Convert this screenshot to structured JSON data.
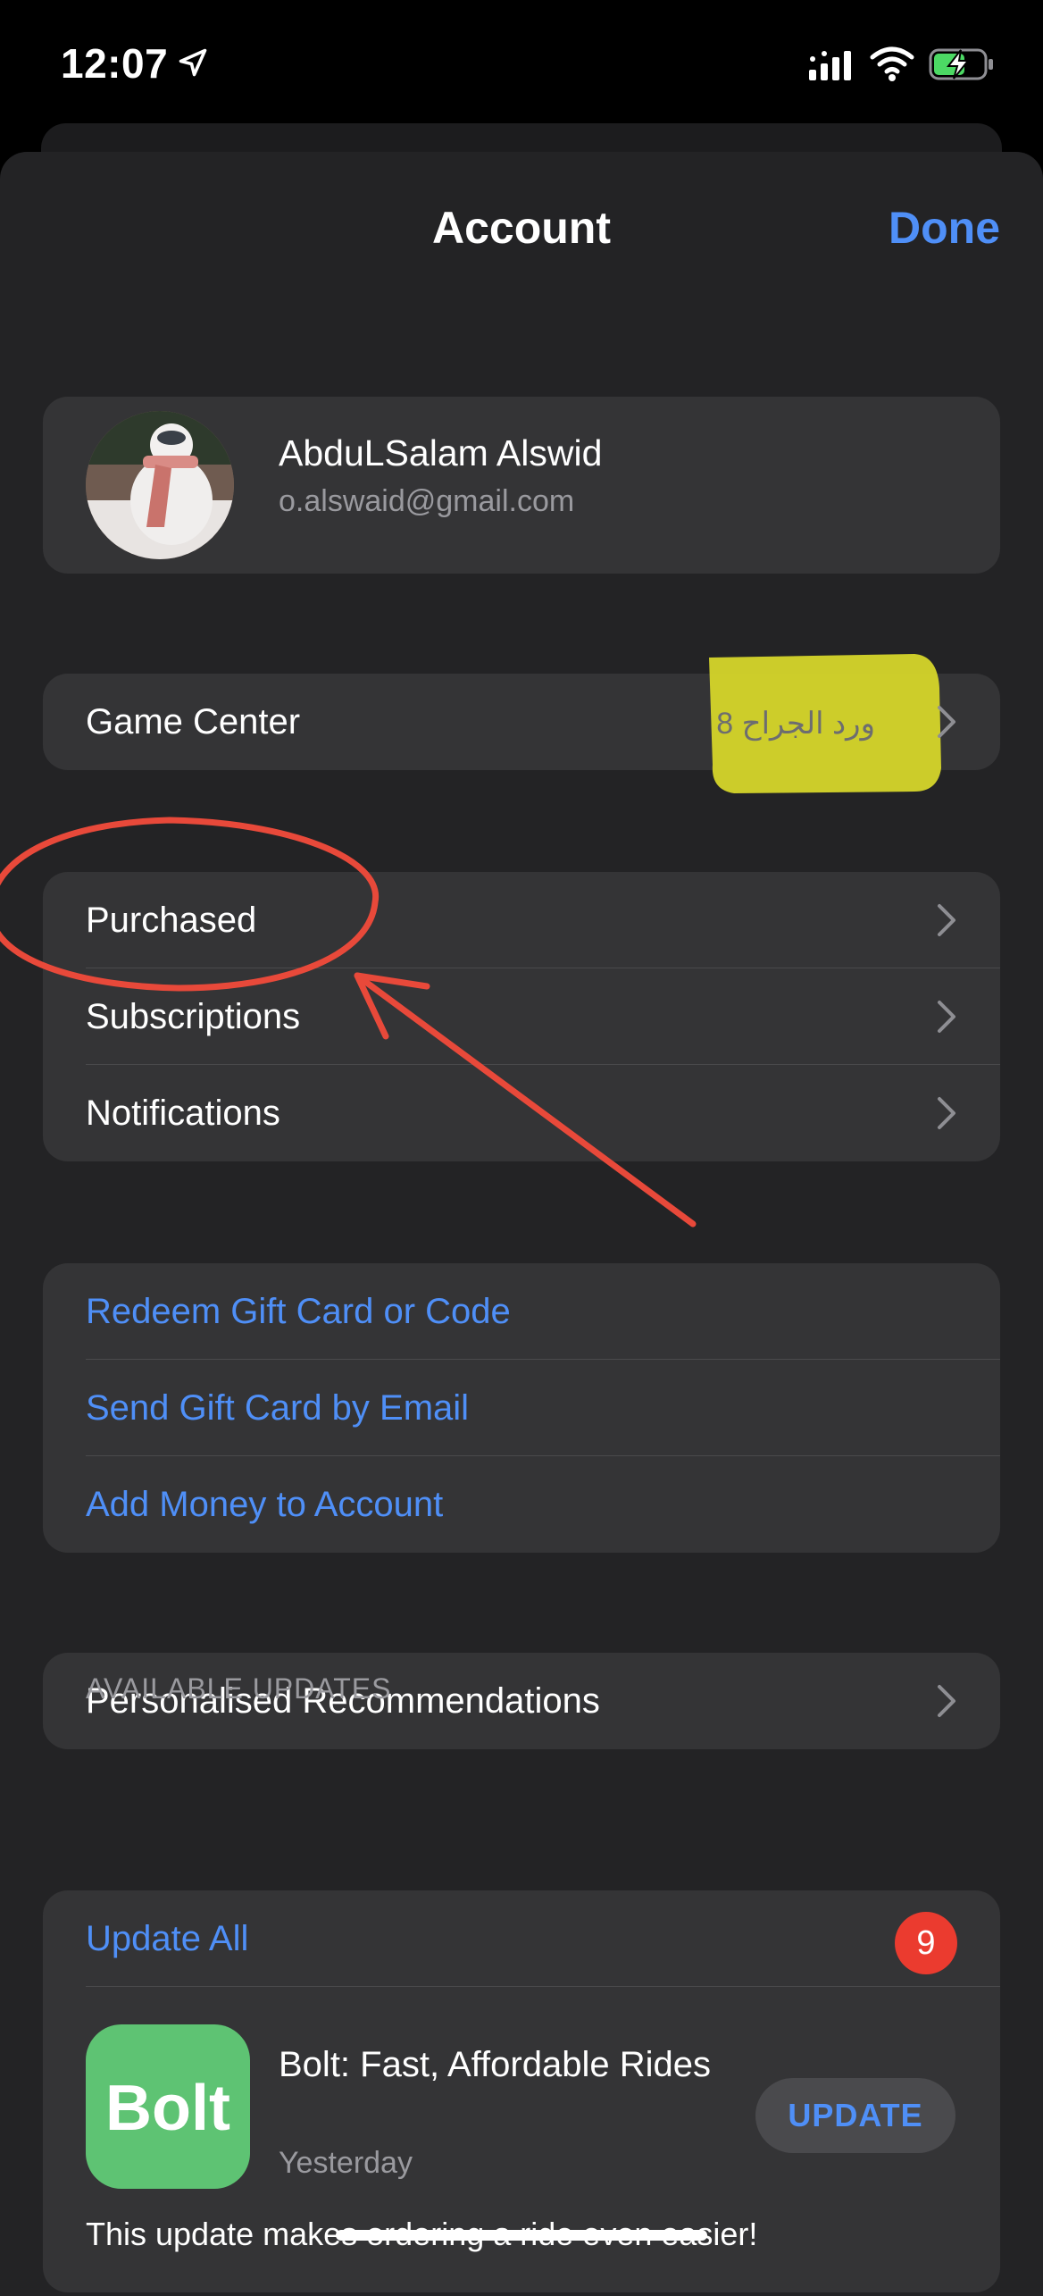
{
  "status_bar": {
    "time": "12:07"
  },
  "header": {
    "title": "Account",
    "done_label": "Done"
  },
  "profile": {
    "name": "AbduLSalam Alswid",
    "email": "o.alswaid@gmail.com"
  },
  "game_center": {
    "label": "Game Center",
    "value": "ورد الجراح 8"
  },
  "menu": [
    {
      "label": "Purchased"
    },
    {
      "label": "Subscriptions"
    },
    {
      "label": "Notifications"
    }
  ],
  "gift_links": [
    {
      "label": "Redeem Gift Card or Code"
    },
    {
      "label": "Send Gift Card by Email"
    },
    {
      "label": "Add Money to Account"
    }
  ],
  "recommendations": {
    "label": "Personalised Recommendations"
  },
  "updates": {
    "section_title": "AVAILABLE UPDATES",
    "update_all_label": "Update All",
    "count": "9",
    "app": {
      "icon_text": "Bolt",
      "name": "Bolt: Fast, Affordable Rides",
      "date": "Yesterday",
      "button_label": "UPDATE",
      "description": "This update makes ordering a ride even easier!"
    }
  },
  "colors": {
    "accent": "#4f8ff7",
    "badge": "#eb3b2f",
    "annotation": "#e8493a",
    "highlight": "#d6d62a"
  }
}
